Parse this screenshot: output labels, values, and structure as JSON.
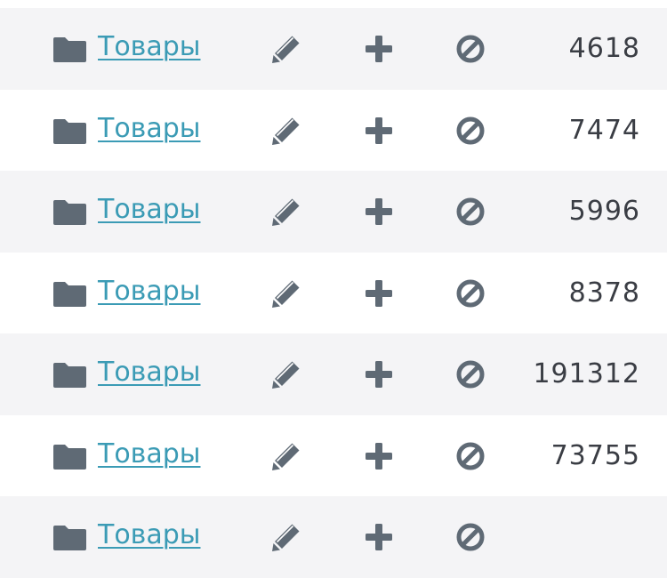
{
  "colors": {
    "link": "#3b9bb5",
    "icon": "#5f6a75",
    "text": "#3a3d44",
    "row_stripe": "#f4f4f6"
  },
  "icons": {
    "row_icon": "folder-icon",
    "edit": "pencil-icon",
    "add": "plus-icon",
    "block": "block-icon"
  },
  "rows": [
    {
      "label": "Товары",
      "count": "4618"
    },
    {
      "label": "Товары",
      "count": "7474"
    },
    {
      "label": "Товары",
      "count": "5996"
    },
    {
      "label": "Товары",
      "count": "8378"
    },
    {
      "label": "Товары",
      "count": "191312"
    },
    {
      "label": "Товары",
      "count": "73755"
    },
    {
      "label": "Товары",
      "count": ""
    }
  ]
}
